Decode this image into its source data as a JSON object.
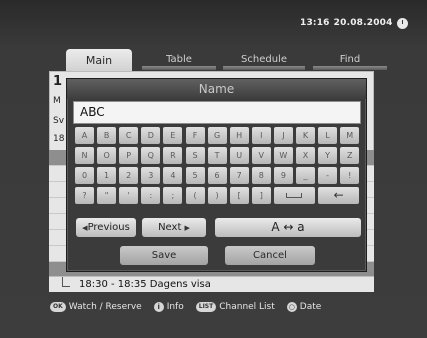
{
  "header": {
    "time": "13:16",
    "date": "20.08.2004",
    "clock_icon": "clock-icon"
  },
  "tabs": [
    {
      "label": "Main",
      "active": true
    },
    {
      "label": "Table",
      "active": false
    },
    {
      "label": "Schedule",
      "active": false
    },
    {
      "label": "Find",
      "active": false
    }
  ],
  "background": {
    "side_glyphs": [
      "1",
      "M",
      "Sv",
      "18"
    ]
  },
  "keyboard_dialog": {
    "title": "Name",
    "input_value": "ABC",
    "keys": [
      "A",
      "B",
      "C",
      "D",
      "E",
      "F",
      "G",
      "H",
      "I",
      "J",
      "K",
      "L",
      "M",
      "N",
      "O",
      "P",
      "Q",
      "R",
      "S",
      "T",
      "U",
      "V",
      "W",
      "X",
      "Y",
      "Z",
      "0",
      "1",
      "2",
      "3",
      "4",
      "5",
      "6",
      "7",
      "8",
      "9",
      "_",
      "-",
      "!",
      "?",
      "\"",
      "'",
      ":",
      ";",
      "(",
      ")",
      "[",
      "]",
      "space",
      "backspace"
    ],
    "previous_label": "Previous",
    "next_label": "Next",
    "case_label": "A ↔ a",
    "save_label": "Save",
    "cancel_label": "Cancel"
  },
  "program_row": {
    "text": "18:30 - 18:35  Dagens visa"
  },
  "footer": {
    "ok_key": "OK",
    "ok_label": "Watch / Reserve",
    "info_key": "i",
    "info_label": "Info",
    "list_key": "LIST",
    "list_label": "Channel List",
    "date_key": "○",
    "date_label": "Date"
  }
}
